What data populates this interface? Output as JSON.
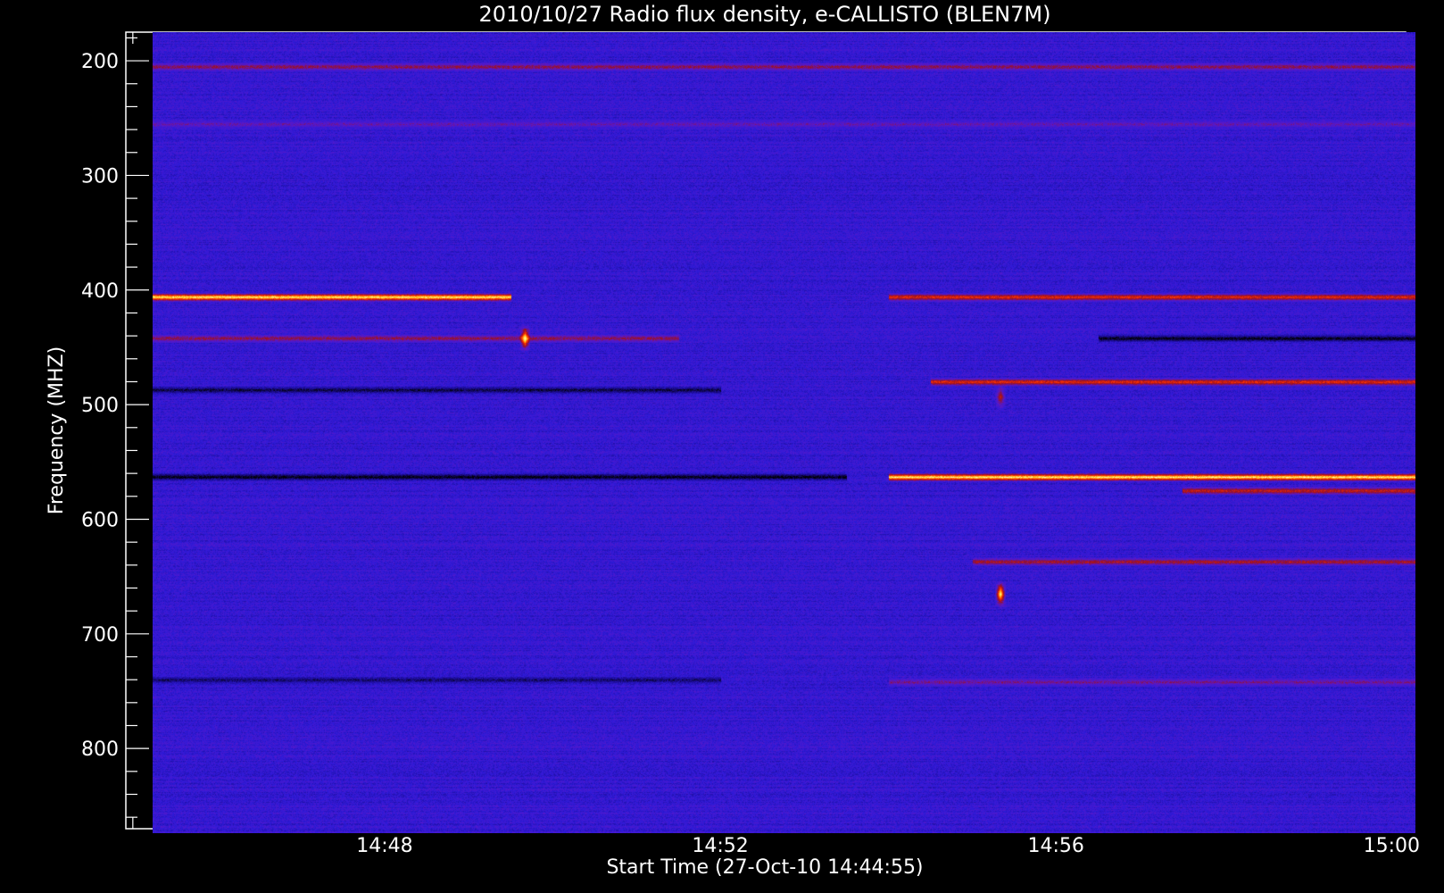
{
  "chart_data": {
    "type": "heatmap",
    "title": "2010/10/27  Radio flux density, e-CALLISTO (BLEN7M)",
    "xlabel": "Start Time (27-Oct-10 14:44:55)",
    "ylabel": "Frequency (MHZ)",
    "x_unit": "time (UT)",
    "xlim": [
      "14:44:55",
      "15:00:10"
    ],
    "ylim": [
      175,
      870
    ],
    "y_inverted": true,
    "y_ticks": [
      200,
      300,
      400,
      500,
      600,
      700,
      800
    ],
    "y_tick_labels": [
      "200",
      "300",
      "400",
      "500",
      "600",
      "700",
      "800"
    ],
    "x_ticks": [
      "14:48",
      "14:52",
      "14:56",
      "15:00"
    ],
    "x_tick_labels": [
      "14:48",
      "14:52",
      "14:56",
      "15:00"
    ],
    "data_start": "14:45:14",
    "data_end": "15:00:17",
    "freq_start": 175,
    "freq_end": 874,
    "colormap": [
      "#000000",
      "#1a0a8c",
      "#2e1ad8",
      "#5a18c8",
      "#9a1020",
      "#ff3000",
      "#ffcc20",
      "#ffffc8"
    ],
    "background_level": 0.3,
    "features": [
      {
        "type": "band",
        "freq": 205,
        "start": "14:45:14",
        "end": "15:00:17",
        "level": 0.55
      },
      {
        "type": "band",
        "freq": 255,
        "start": "14:45:14",
        "end": "15:00:17",
        "level": 0.45
      },
      {
        "type": "band",
        "freq": 406,
        "start": "14:45:14",
        "end": "14:49:30",
        "level": 0.95
      },
      {
        "type": "band",
        "freq": 406,
        "start": "14:54:00",
        "end": "15:00:17",
        "level": 0.7
      },
      {
        "type": "band",
        "freq": 442,
        "start": "14:45:14",
        "end": "14:51:30",
        "level": 0.55
      },
      {
        "type": "band",
        "freq": 442,
        "start": "14:56:30",
        "end": "15:00:17",
        "level": 0.0
      },
      {
        "type": "band",
        "freq": 480,
        "start": "14:54:30",
        "end": "15:00:17",
        "level": 0.7
      },
      {
        "type": "band",
        "freq": 487,
        "start": "14:45:14",
        "end": "14:52:00",
        "level": 0.05
      },
      {
        "type": "band",
        "freq": 563,
        "start": "14:45:14",
        "end": "14:53:30",
        "level": 0.0
      },
      {
        "type": "band",
        "freq": 563,
        "start": "14:54:00",
        "end": "15:00:17",
        "level": 0.95
      },
      {
        "type": "band",
        "freq": 575,
        "start": "14:57:30",
        "end": "15:00:17",
        "level": 0.65
      },
      {
        "type": "band",
        "freq": 637,
        "start": "14:55:00",
        "end": "15:00:17",
        "level": 0.6
      },
      {
        "type": "band",
        "freq": 740,
        "start": "14:45:14",
        "end": "14:52:00",
        "level": 0.1
      },
      {
        "type": "band",
        "freq": 742,
        "start": "14:54:00",
        "end": "15:00:17",
        "level": 0.5
      },
      {
        "type": "spot",
        "freq": 442,
        "time": "14:49:40",
        "level": 1.0
      },
      {
        "type": "spot",
        "freq": 665,
        "time": "14:55:20",
        "level": 1.0
      },
      {
        "type": "spot",
        "freq": 493,
        "time": "14:55:20",
        "level": 0.65
      }
    ]
  }
}
